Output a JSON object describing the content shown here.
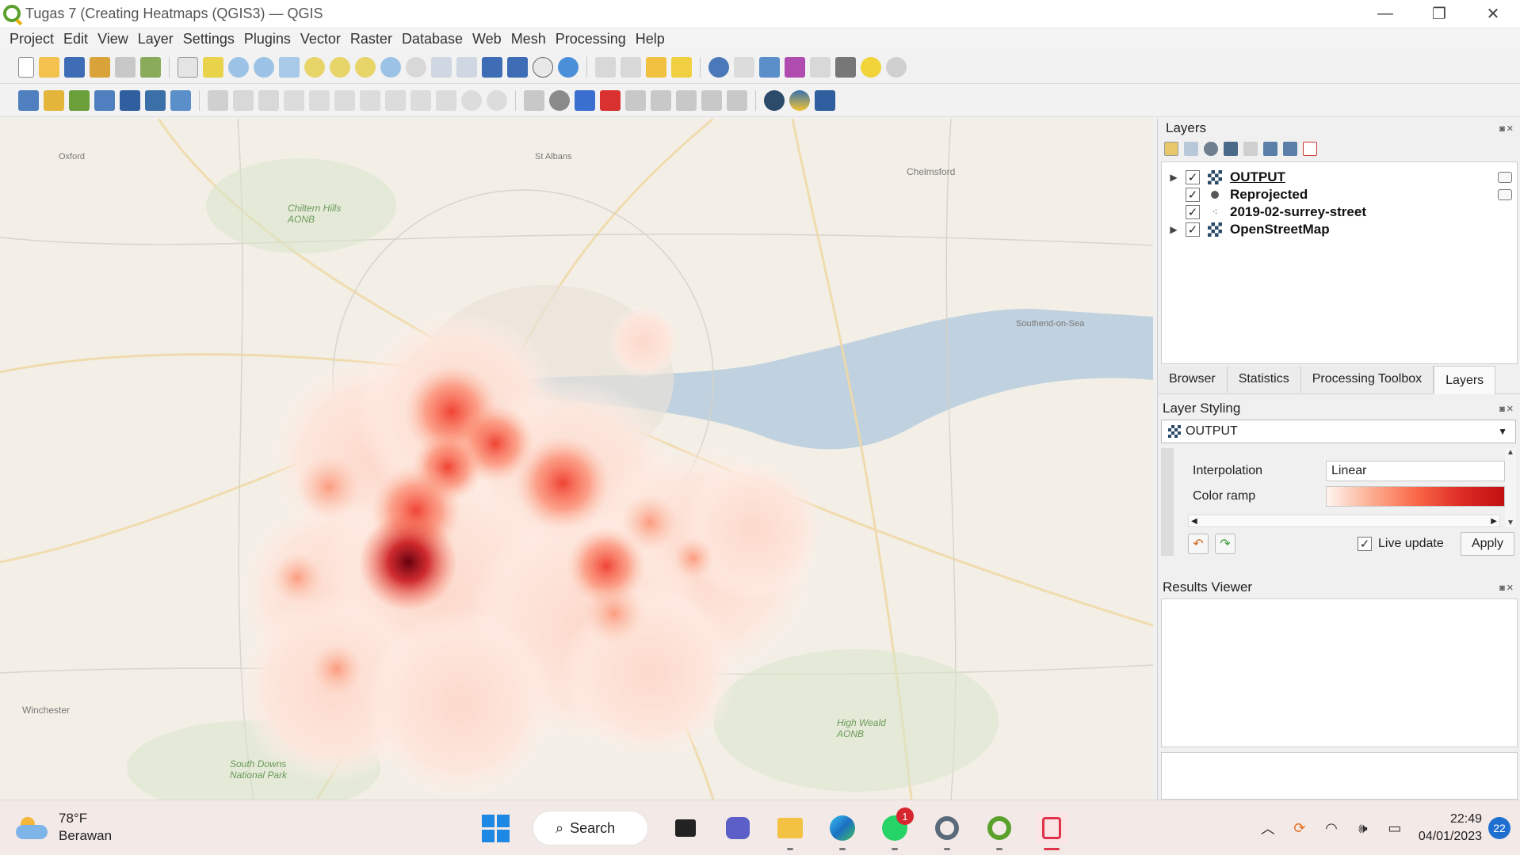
{
  "window": {
    "title": "Tugas 7 (Creating Heatmaps (QGIS3) — QGIS",
    "controls": [
      "minimize",
      "restore",
      "close"
    ]
  },
  "menu": [
    "Project",
    "Edit",
    "View",
    "Layer",
    "Settings",
    "Plugins",
    "Vector",
    "Raster",
    "Database",
    "Web",
    "Mesh",
    "Processing",
    "Help"
  ],
  "map": {
    "places": [
      {
        "name": "Oxford"
      },
      {
        "name": "St Albans"
      },
      {
        "name": "Chelmsford"
      },
      {
        "name": "Chiltern Hills AONB"
      },
      {
        "name": "Southend-on-Sea"
      },
      {
        "name": "Winchester"
      },
      {
        "name": "High Weald AONB"
      },
      {
        "name": "South Downs National Park"
      }
    ],
    "heatmap_colors": [
      "#fff5f0",
      "#fcbba1",
      "#fb6a4a",
      "#de2d26",
      "#67000d"
    ]
  },
  "layers_panel": {
    "title": "Layers",
    "float_controls": "◙✕",
    "layers": [
      {
        "name": "OUTPUT",
        "checked": true,
        "expandable": true,
        "active": true,
        "icon": "raster-icon"
      },
      {
        "name": "Reprojected",
        "checked": true,
        "expandable": false,
        "icon": "point-icon"
      },
      {
        "name": "2019-02-surrey-street",
        "checked": true,
        "expandable": false,
        "icon": "delimited-points-icon"
      },
      {
        "name": "OpenStreetMap",
        "checked": true,
        "expandable": true,
        "icon": "raster-icon"
      }
    ],
    "check_mark": "✓",
    "expand_arrow": "▶"
  },
  "tabs": [
    "Browser",
    "Statistics",
    "Processing Toolbox",
    "Layers"
  ],
  "active_tab": "Layers",
  "layer_styling": {
    "title": "Layer Styling",
    "selected_layer": "OUTPUT",
    "interpolation_label": "Interpolation",
    "interpolation_value": "Linear",
    "color_ramp_label": "Color ramp",
    "live_update_label": "Live update",
    "live_update_checked": true,
    "apply_label": "Apply"
  },
  "results_viewer": {
    "title": "Results Viewer"
  },
  "taskbar": {
    "temperature": "78°F",
    "weather": "Berawan",
    "search_label": "Search",
    "whatsapp_badge": "1",
    "time": "22:49",
    "date": "04/01/2023",
    "notifications": "22"
  }
}
